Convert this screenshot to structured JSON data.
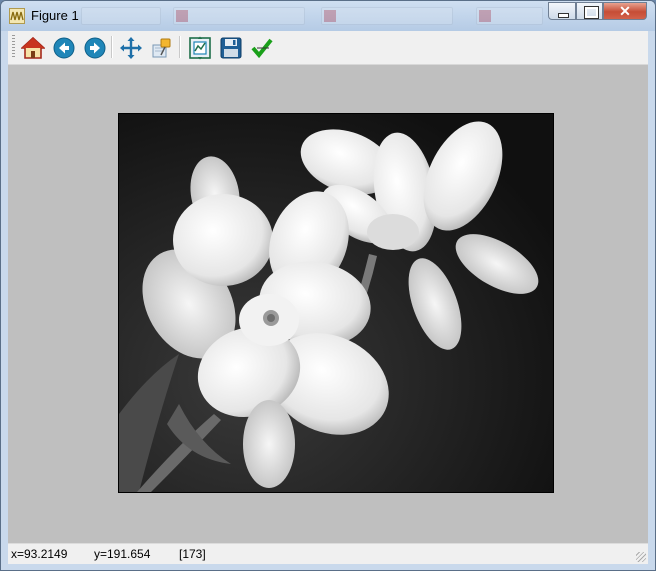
{
  "window": {
    "title": "Figure 1"
  },
  "caption_buttons": {
    "close_glyph": "✕"
  },
  "toolbar": {
    "buttons": [
      {
        "icon": "home-icon",
        "tooltip": "Home"
      },
      {
        "icon": "back-icon",
        "tooltip": "Back"
      },
      {
        "icon": "forward-icon",
        "tooltip": "Forward"
      },
      {
        "icon": "pan-icon",
        "tooltip": "Pan"
      },
      {
        "icon": "zoom-icon",
        "tooltip": "Zoom"
      },
      {
        "icon": "subplots-icon",
        "tooltip": "Configure subplots"
      },
      {
        "icon": "save-icon",
        "tooltip": "Save"
      },
      {
        "icon": "edit-check-icon",
        "tooltip": "Edit parameters"
      }
    ]
  },
  "status": {
    "x": "x=93.2149",
    "y": "y=191.654",
    "value": "[173]"
  },
  "colors": {
    "canvas_bg": "#bfbfbf",
    "toolbar_bg": "#f0f0f0",
    "title_bar": "#b5cbe5"
  }
}
